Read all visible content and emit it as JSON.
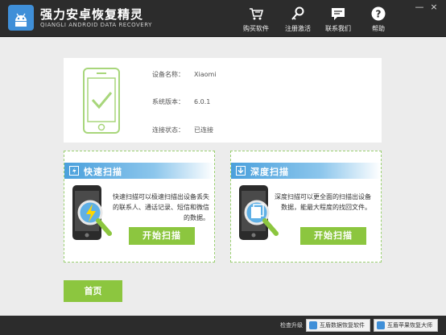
{
  "app": {
    "title": "强力安卓恢复精灵",
    "subtitle": "QIANGLI ANDROID DATA RECOVERY"
  },
  "toolbar": {
    "buy": {
      "label": "购买软件",
      "icon": "cart-icon"
    },
    "register": {
      "label": "注册激活",
      "icon": "key-icon"
    },
    "contact": {
      "label": "联系我们",
      "icon": "chat-icon"
    },
    "help": {
      "label": "帮助",
      "icon": "help-icon"
    }
  },
  "window_controls": {
    "minimize": "—",
    "close": "×"
  },
  "device": {
    "name_label": "设备名称：",
    "name_value": "Xiaomi",
    "version_label": "系统版本：",
    "version_value": "6.0.1",
    "status_label": "连接状态：",
    "status_value": "已连接"
  },
  "quick_scan": {
    "title": "快速扫描",
    "desc": "快速扫描可以极速扫描出设备丢失的联系人、通话记录、短信和微信的数据。",
    "button": "开始扫描"
  },
  "deep_scan": {
    "title": "深度扫描",
    "desc": "深度扫描可以更全面的扫描出设备数据，能最大程度的找回文件。",
    "button": "开始扫描"
  },
  "home_button": "首页",
  "footer": {
    "label": "检查升级",
    "link1": "互盾数据恢复软件",
    "link2": "互盾苹果恢复大师"
  },
  "colors": {
    "titlebar": "#2c2c2c",
    "accent_green": "#8cc63f",
    "accent_blue": "#4aa0dc",
    "dashed_border": "#9bd072"
  }
}
